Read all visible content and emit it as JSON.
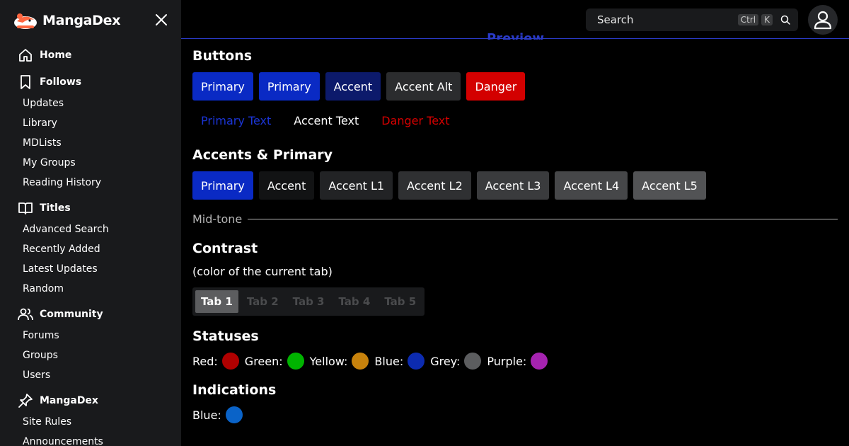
{
  "app": {
    "name": "MangaDex"
  },
  "sidebar": {
    "sections": [
      {
        "title": "Home",
        "icon": "home-icon",
        "links": []
      },
      {
        "title": "Follows",
        "icon": "bookmark-icon",
        "links": [
          "Updates",
          "Library",
          "MDLists",
          "My Groups",
          "Reading History"
        ]
      },
      {
        "title": "Titles",
        "icon": "book-open-icon",
        "links": [
          "Advanced Search",
          "Recently Added",
          "Latest Updates",
          "Random"
        ]
      },
      {
        "title": "Community",
        "icon": "users-icon",
        "links": [
          "Forums",
          "Groups",
          "Users"
        ]
      },
      {
        "title": "MangaDex",
        "icon": "pin-icon",
        "links": [
          "Site Rules",
          "Announcements"
        ]
      }
    ]
  },
  "header": {
    "search_placeholder": "Search",
    "kbd_ctrl": "Ctrl",
    "kbd_k": "K",
    "preview_label": "Preview"
  },
  "sections": {
    "buttons": {
      "title": "Buttons",
      "buttons": [
        {
          "label": "Primary",
          "bg": "#0a2ac4"
        },
        {
          "label": "Primary",
          "bg": "#0a2ac4"
        },
        {
          "label": "Accent",
          "bg": "#0c1a6b"
        },
        {
          "label": "Accent Alt",
          "bg": "#2b2c2e"
        },
        {
          "label": "Danger",
          "bg": "#d30000"
        }
      ],
      "text_buttons": [
        {
          "label": "Primary Text",
          "color": "#1b35d6"
        },
        {
          "label": "Accent Text",
          "color": "#ffffff"
        },
        {
          "label": "Danger Text",
          "color": "#d30000"
        }
      ]
    },
    "accents": {
      "title": "Accents & Primary",
      "swatches": [
        {
          "label": "Primary",
          "bg": "#0a2ac4"
        },
        {
          "label": "Accent",
          "bg": "#121314"
        },
        {
          "label": "Accent L1",
          "bg": "#222325"
        },
        {
          "label": "Accent L2",
          "bg": "#2f3032"
        },
        {
          "label": "Accent L3",
          "bg": "#3a3b3d"
        },
        {
          "label": "Accent L4",
          "bg": "#464749"
        },
        {
          "label": "Accent L5",
          "bg": "#525355"
        }
      ],
      "midtone_label": "Mid-tone"
    },
    "contrast": {
      "title": "Contrast",
      "subtitle": "(color of the current tab)",
      "tabs": [
        "Tab 1",
        "Tab 2",
        "Tab 3",
        "Tab 4",
        "Tab 5"
      ],
      "active_tab": 0
    },
    "statuses": {
      "title": "Statuses",
      "items": [
        {
          "label": "Red:",
          "color": "#b00000"
        },
        {
          "label": "Green:",
          "color": "#00b300"
        },
        {
          "label": "Yellow:",
          "color": "#c7820c"
        },
        {
          "label": "Blue:",
          "color": "#0c2bb0"
        },
        {
          "label": "Grey:",
          "color": "#5c5d5f"
        },
        {
          "label": "Purple:",
          "color": "#a523b0"
        }
      ]
    },
    "indications": {
      "title": "Indications",
      "items": [
        {
          "label": "Blue:",
          "color": "#0a63c8"
        }
      ]
    }
  }
}
